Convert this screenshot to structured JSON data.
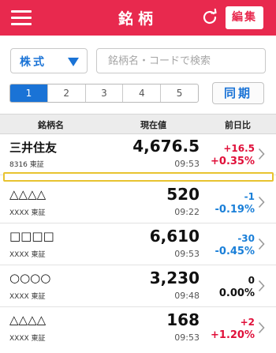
{
  "header": {
    "title": "銘柄",
    "edit_label": "編集",
    "menu_icon": "hamburger-menu-icon",
    "refresh_icon": "refresh-icon",
    "color": "#e8294e"
  },
  "filters": {
    "type_selected": "株式",
    "search_placeholder": "銘柄名・コードで検索",
    "search_value": ""
  },
  "pages": {
    "tabs": [
      "1",
      "2",
      "3",
      "4",
      "5"
    ],
    "active": "1",
    "sync_label": "同期"
  },
  "columns": {
    "name": "銘柄名",
    "price": "現在値",
    "change": "前日比"
  },
  "rows": [
    {
      "name": "三井住友",
      "code": "8316",
      "market": "東証",
      "price": "4,676.5",
      "time": "09:53",
      "change": "+16.5",
      "percent": "+0.35%",
      "direction": "up"
    },
    {
      "name": "△△△△",
      "code": "XXXX",
      "market": "東証",
      "price": "520",
      "time": "09:22",
      "change": "-1",
      "percent": "-0.19%",
      "direction": "down"
    },
    {
      "name": "□□□□",
      "code": "XXXX",
      "market": "東証",
      "price": "6,610",
      "time": "09:53",
      "change": "-30",
      "percent": "-0.45%",
      "direction": "down"
    },
    {
      "name": "○○○○",
      "code": "XXXX",
      "market": "東証",
      "price": "3,230",
      "time": "09:48",
      "change": "0",
      "percent": "0.00%",
      "direction": "flat"
    },
    {
      "name": "△△△△",
      "code": "XXXX",
      "market": "東証",
      "price": "168",
      "time": "09:53",
      "change": "+2",
      "percent": "+1.20%",
      "direction": "up"
    }
  ],
  "colors": {
    "accent_red": "#e8294e",
    "accent_blue": "#1a73d6",
    "up": "#e0103a",
    "down": "#1a7fd8",
    "highlight": "#e8c330"
  }
}
